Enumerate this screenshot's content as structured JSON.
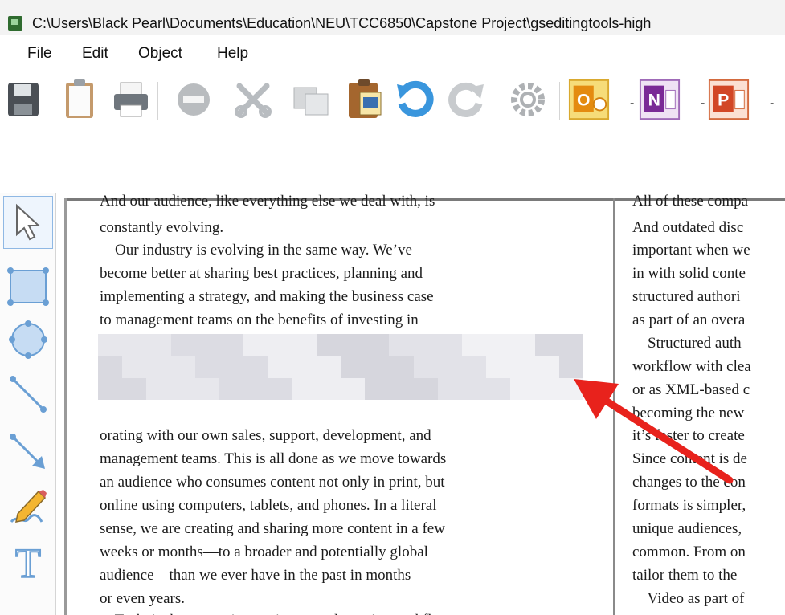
{
  "window": {
    "title": "C:\\Users\\Black Pearl\\Documents\\Education\\NEU\\TCC6850\\Capstone Project\\gseditingtools-high"
  },
  "menu": {
    "items": [
      "File",
      "Edit",
      "Object",
      "Help"
    ]
  },
  "toolbar": {
    "buttons": [
      "save-icon",
      "clipboard-icon",
      "print-icon",
      "remove-icon",
      "cut-icon",
      "copy-icon",
      "paste-icon",
      "undo-icon",
      "redo-icon",
      "settings-icon",
      "outlook-icon",
      "onenote-icon",
      "powerpoint-icon"
    ],
    "app_letters": {
      "outlook": "O",
      "onenote": "N",
      "powerpoint": "P"
    },
    "dropdown_glyph": "-"
  },
  "tools": {
    "items": [
      "select-arrow-icon",
      "rectangle-icon",
      "ellipse-icon",
      "line-icon",
      "arrow-line-icon",
      "pencil-icon",
      "text-icon"
    ],
    "text_tool_letter": "T"
  },
  "document": {
    "left_column": [
      "And our audience, like everything else we deal with, is",
      "constantly evolving.",
      "    Our industry is evolving in the same way. We’ve",
      "become better at sharing best practices, planning and",
      "implementing a strategy, and making the business case",
      "to management teams on the benefits of investing in",
      "",
      "",
      "",
      "orating with our own sales, support, development, and",
      "management teams. This is all done as we move towards",
      "an audience who consumes content not only in print, but",
      "online using computers, tablets, and phones. In a literal",
      "sense, we are creating and sharing more content in a few",
      "weeks or months—to a broader and potentially global",
      "audience—than we ever have in the past in months",
      "or even years.",
      "    Technical communicators improve the entire workflow."
    ],
    "right_column": [
      "All of these compa",
      "And outdated disc",
      "important when we",
      "in with solid conte",
      "structured authori",
      "as part of an overa",
      "    Structured auth",
      "workflow with clea",
      "or as XML-based c",
      "becoming the new",
      "it’s faster to create",
      "Since content is de",
      "changes to the con",
      "formats is simpler,",
      "unique audiences,",
      "common. From on",
      "tailor them to the",
      "    Video as part of"
    ]
  },
  "annotation": {
    "arrow_color": "#e8221c",
    "redaction": "pixelated-blur"
  }
}
